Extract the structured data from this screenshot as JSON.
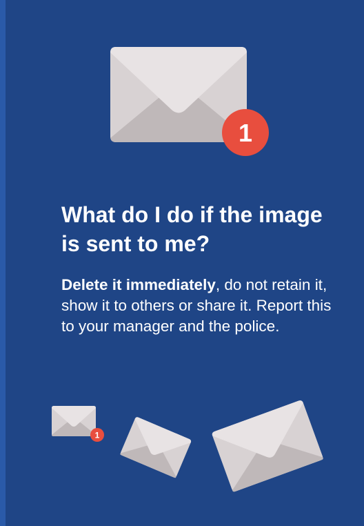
{
  "heading": "What do I do if the image is sent to me?",
  "body": {
    "emphasis": "Delete it immediately",
    "rest": ", do not retain it, show it to others or share it. Report this to your manager and the police."
  },
  "badges": {
    "main_count": "1",
    "small_count": "1"
  },
  "icons": {
    "hero": "envelope-notification-icon",
    "small": "envelope-notification-icon",
    "tilted_medium": "envelope-icon",
    "tilted_large": "envelope-icon"
  },
  "colors": {
    "background": "#1f4586",
    "left_edge": "#2a5aa8",
    "envelope_light": "#e6e1e2",
    "envelope_mid": "#cfc9ca",
    "envelope_dark": "#bdb6b7",
    "badge": "#e84e3e",
    "text": "#ffffff"
  }
}
